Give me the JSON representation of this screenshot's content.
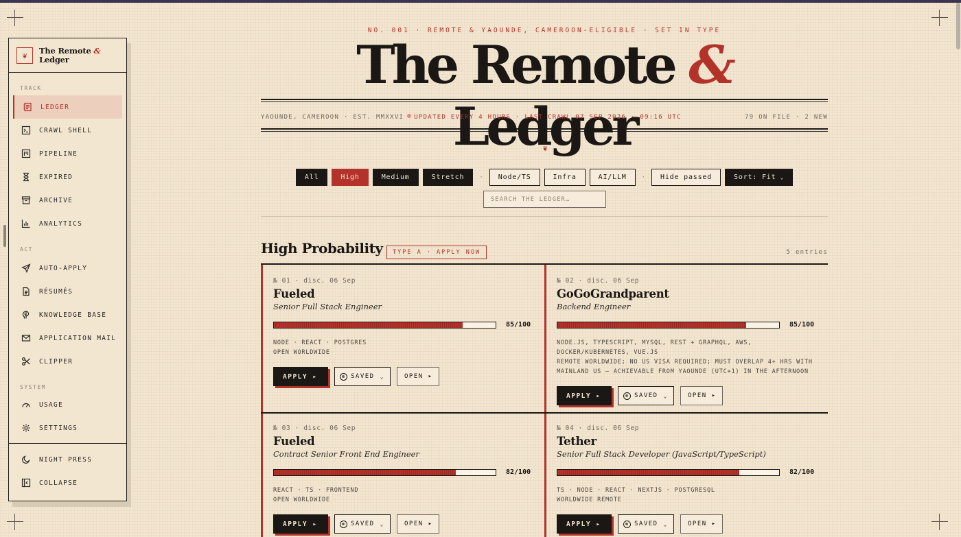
{
  "masthead": {
    "kicker": "NO. 001 · REMOTE & YAOUNDE, CAMEROON-ELIGIBLE · SET IN TYPE",
    "title_a": "The Remote ",
    "title_amp": "&",
    "title_b": " Ledger",
    "location": "YAOUNDE, CAMEROON · EST. MMXXVI",
    "status": "UPDATED EVERY 4 HOURS · LAST CRAWL 07 SEP 2026 · 09:16 UTC",
    "counts": "79 ON FILE · 2 NEW",
    "ornament": "❦"
  },
  "sidebar": {
    "brand_a": "The Remote ",
    "brand_amp": "&",
    "brand_b": "Ledger",
    "brand_mark": "❦",
    "track_label": "TRACK",
    "act_label": "ACT",
    "system_label": "SYSTEM",
    "track": [
      {
        "label": "LEDGER",
        "icon": "ledger-icon"
      },
      {
        "label": "CRAWL SHELL",
        "icon": "terminal-icon"
      },
      {
        "label": "PIPELINE",
        "icon": "pipeline-icon"
      },
      {
        "label": "EXPIRED",
        "icon": "hourglass-icon"
      },
      {
        "label": "ARCHIVE",
        "icon": "archive-icon"
      },
      {
        "label": "ANALYTICS",
        "icon": "bar-chart-icon"
      }
    ],
    "act": [
      {
        "label": "AUTO-APPLY",
        "icon": "send-icon"
      },
      {
        "label": "RÉSUMÉS",
        "icon": "document-icon"
      },
      {
        "label": "KNOWLEDGE BASE",
        "icon": "brain-icon"
      },
      {
        "label": "APPLICATION MAIL",
        "icon": "mail-icon"
      },
      {
        "label": "CLIPPER",
        "icon": "scissors-icon"
      }
    ],
    "system": [
      {
        "label": "USAGE",
        "icon": "gauge-icon"
      },
      {
        "label": "SETTINGS",
        "icon": "gear-icon"
      }
    ],
    "bottom": [
      {
        "label": "NIGHT PRESS",
        "icon": "moon-icon"
      },
      {
        "label": "COLLAPSE",
        "icon": "collapse-icon"
      }
    ]
  },
  "filters": {
    "probability": [
      "All",
      "High",
      "Medium",
      "Stretch"
    ],
    "active": "High",
    "stacks": [
      "Node/TS",
      "Infra",
      "AI/LLM"
    ],
    "hide_passed": "Hide passed",
    "sort": "Sort: Fit",
    "separator": "·",
    "search_placeholder": "SEARCH THE LEDGER…"
  },
  "section": {
    "title": "High Probability",
    "badge": "TYPE A · APPLY NOW",
    "count": "5 entries"
  },
  "cards": [
    {
      "meta": "№ 01 · disc. 06 Sep",
      "company": "Fueled",
      "role": "Senior Full Stack Engineer",
      "score": 85,
      "score_label": "85/100",
      "tags": "NODE · REACT · POSTGRES",
      "note": "OPEN WORLDWIDE",
      "apply": "APPLY ▸",
      "saved": "SAVED",
      "open": "OPEN ▸"
    },
    {
      "meta": "№ 02 · disc. 06 Sep",
      "company": "GoGoGrandparent",
      "role": "Backend Engineer",
      "score": 85,
      "score_label": "85/100",
      "tags": "NODE.JS, TYPESCRIPT, MYSQL, REST + GRAPHQL, AWS, DOCKER/KUBERNETES, VUE.JS",
      "note": "REMOTE WORLDWIDE; NO US VISA REQUIRED; MUST OVERLAP 4+ HRS WITH MAINLAND US — ACHIEVABLE FROM YAOUNDE (UTC+1) IN THE AFTERNOON",
      "apply": "APPLY ▸",
      "saved": "SAVED",
      "open": "OPEN ▸"
    },
    {
      "meta": "№ 03 · disc. 06 Sep",
      "company": "Fueled",
      "role": "Contract Senior Front End Engineer",
      "score": 82,
      "score_label": "82/100",
      "tags": "REACT · TS · FRONTEND",
      "note": "OPEN WORLDWIDE",
      "apply": "APPLY ▸",
      "saved": "SAVED",
      "open": "OPEN ▸"
    },
    {
      "meta": "№ 04 · disc. 06 Sep",
      "company": "Tether",
      "role": "Senior Full Stack Developer (JavaScript/TypeScript)",
      "score": 82,
      "score_label": "82/100",
      "tags": "TS · NODE · REACT · NEXTJS · POSTGRESQL",
      "note": "WORLDWIDE REMOTE",
      "apply": "APPLY ▸",
      "saved": "SAVED",
      "open": "OPEN ▸"
    }
  ],
  "colors": {
    "accent": "#b3322a",
    "ink": "#1a1714",
    "paper": "#f3e6d1"
  }
}
